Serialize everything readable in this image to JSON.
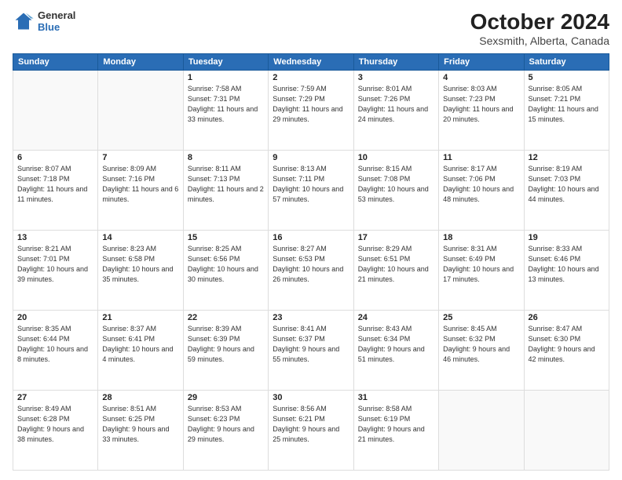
{
  "header": {
    "logo_line1": "General",
    "logo_line2": "Blue",
    "month": "October 2024",
    "location": "Sexsmith, Alberta, Canada"
  },
  "days_of_week": [
    "Sunday",
    "Monday",
    "Tuesday",
    "Wednesday",
    "Thursday",
    "Friday",
    "Saturday"
  ],
  "weeks": [
    [
      {
        "day": "",
        "empty": true
      },
      {
        "day": "",
        "empty": true
      },
      {
        "day": "1",
        "sunrise": "Sunrise: 7:58 AM",
        "sunset": "Sunset: 7:31 PM",
        "daylight": "Daylight: 11 hours and 33 minutes."
      },
      {
        "day": "2",
        "sunrise": "Sunrise: 7:59 AM",
        "sunset": "Sunset: 7:29 PM",
        "daylight": "Daylight: 11 hours and 29 minutes."
      },
      {
        "day": "3",
        "sunrise": "Sunrise: 8:01 AM",
        "sunset": "Sunset: 7:26 PM",
        "daylight": "Daylight: 11 hours and 24 minutes."
      },
      {
        "day": "4",
        "sunrise": "Sunrise: 8:03 AM",
        "sunset": "Sunset: 7:23 PM",
        "daylight": "Daylight: 11 hours and 20 minutes."
      },
      {
        "day": "5",
        "sunrise": "Sunrise: 8:05 AM",
        "sunset": "Sunset: 7:21 PM",
        "daylight": "Daylight: 11 hours and 15 minutes."
      }
    ],
    [
      {
        "day": "6",
        "sunrise": "Sunrise: 8:07 AM",
        "sunset": "Sunset: 7:18 PM",
        "daylight": "Daylight: 11 hours and 11 minutes."
      },
      {
        "day": "7",
        "sunrise": "Sunrise: 8:09 AM",
        "sunset": "Sunset: 7:16 PM",
        "daylight": "Daylight: 11 hours and 6 minutes."
      },
      {
        "day": "8",
        "sunrise": "Sunrise: 8:11 AM",
        "sunset": "Sunset: 7:13 PM",
        "daylight": "Daylight: 11 hours and 2 minutes."
      },
      {
        "day": "9",
        "sunrise": "Sunrise: 8:13 AM",
        "sunset": "Sunset: 7:11 PM",
        "daylight": "Daylight: 10 hours and 57 minutes."
      },
      {
        "day": "10",
        "sunrise": "Sunrise: 8:15 AM",
        "sunset": "Sunset: 7:08 PM",
        "daylight": "Daylight: 10 hours and 53 minutes."
      },
      {
        "day": "11",
        "sunrise": "Sunrise: 8:17 AM",
        "sunset": "Sunset: 7:06 PM",
        "daylight": "Daylight: 10 hours and 48 minutes."
      },
      {
        "day": "12",
        "sunrise": "Sunrise: 8:19 AM",
        "sunset": "Sunset: 7:03 PM",
        "daylight": "Daylight: 10 hours and 44 minutes."
      }
    ],
    [
      {
        "day": "13",
        "sunrise": "Sunrise: 8:21 AM",
        "sunset": "Sunset: 7:01 PM",
        "daylight": "Daylight: 10 hours and 39 minutes."
      },
      {
        "day": "14",
        "sunrise": "Sunrise: 8:23 AM",
        "sunset": "Sunset: 6:58 PM",
        "daylight": "Daylight: 10 hours and 35 minutes."
      },
      {
        "day": "15",
        "sunrise": "Sunrise: 8:25 AM",
        "sunset": "Sunset: 6:56 PM",
        "daylight": "Daylight: 10 hours and 30 minutes."
      },
      {
        "day": "16",
        "sunrise": "Sunrise: 8:27 AM",
        "sunset": "Sunset: 6:53 PM",
        "daylight": "Daylight: 10 hours and 26 minutes."
      },
      {
        "day": "17",
        "sunrise": "Sunrise: 8:29 AM",
        "sunset": "Sunset: 6:51 PM",
        "daylight": "Daylight: 10 hours and 21 minutes."
      },
      {
        "day": "18",
        "sunrise": "Sunrise: 8:31 AM",
        "sunset": "Sunset: 6:49 PM",
        "daylight": "Daylight: 10 hours and 17 minutes."
      },
      {
        "day": "19",
        "sunrise": "Sunrise: 8:33 AM",
        "sunset": "Sunset: 6:46 PM",
        "daylight": "Daylight: 10 hours and 13 minutes."
      }
    ],
    [
      {
        "day": "20",
        "sunrise": "Sunrise: 8:35 AM",
        "sunset": "Sunset: 6:44 PM",
        "daylight": "Daylight: 10 hours and 8 minutes."
      },
      {
        "day": "21",
        "sunrise": "Sunrise: 8:37 AM",
        "sunset": "Sunset: 6:41 PM",
        "daylight": "Daylight: 10 hours and 4 minutes."
      },
      {
        "day": "22",
        "sunrise": "Sunrise: 8:39 AM",
        "sunset": "Sunset: 6:39 PM",
        "daylight": "Daylight: 9 hours and 59 minutes."
      },
      {
        "day": "23",
        "sunrise": "Sunrise: 8:41 AM",
        "sunset": "Sunset: 6:37 PM",
        "daylight": "Daylight: 9 hours and 55 minutes."
      },
      {
        "day": "24",
        "sunrise": "Sunrise: 8:43 AM",
        "sunset": "Sunset: 6:34 PM",
        "daylight": "Daylight: 9 hours and 51 minutes."
      },
      {
        "day": "25",
        "sunrise": "Sunrise: 8:45 AM",
        "sunset": "Sunset: 6:32 PM",
        "daylight": "Daylight: 9 hours and 46 minutes."
      },
      {
        "day": "26",
        "sunrise": "Sunrise: 8:47 AM",
        "sunset": "Sunset: 6:30 PM",
        "daylight": "Daylight: 9 hours and 42 minutes."
      }
    ],
    [
      {
        "day": "27",
        "sunrise": "Sunrise: 8:49 AM",
        "sunset": "Sunset: 6:28 PM",
        "daylight": "Daylight: 9 hours and 38 minutes."
      },
      {
        "day": "28",
        "sunrise": "Sunrise: 8:51 AM",
        "sunset": "Sunset: 6:25 PM",
        "daylight": "Daylight: 9 hours and 33 minutes."
      },
      {
        "day": "29",
        "sunrise": "Sunrise: 8:53 AM",
        "sunset": "Sunset: 6:23 PM",
        "daylight": "Daylight: 9 hours and 29 minutes."
      },
      {
        "day": "30",
        "sunrise": "Sunrise: 8:56 AM",
        "sunset": "Sunset: 6:21 PM",
        "daylight": "Daylight: 9 hours and 25 minutes."
      },
      {
        "day": "31",
        "sunrise": "Sunrise: 8:58 AM",
        "sunset": "Sunset: 6:19 PM",
        "daylight": "Daylight: 9 hours and 21 minutes."
      },
      {
        "day": "",
        "empty": true
      },
      {
        "day": "",
        "empty": true
      }
    ]
  ]
}
